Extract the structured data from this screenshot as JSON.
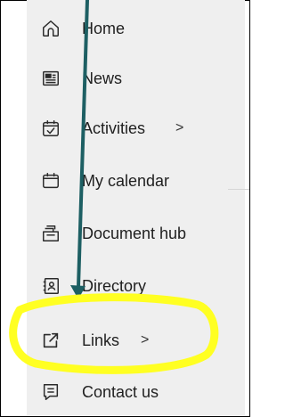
{
  "nav": {
    "items": [
      {
        "label": "Home",
        "icon": "home-icon"
      },
      {
        "label": "News",
        "icon": "newspaper-icon"
      },
      {
        "label": "Activities",
        "icon": "calendar-check-icon",
        "chevron": ">"
      },
      {
        "label": "My calendar",
        "icon": "calendar-icon"
      },
      {
        "label": "Document hub",
        "icon": "documents-icon"
      },
      {
        "label": "Directory",
        "icon": "contact-card-icon"
      },
      {
        "label": "Links",
        "icon": "external-link-icon",
        "chevron": ">"
      },
      {
        "label": "Contact us",
        "icon": "message-icon"
      }
    ]
  },
  "annotation": {
    "arrow_color": "#1d5f63",
    "highlight_color": "#ffff22"
  }
}
